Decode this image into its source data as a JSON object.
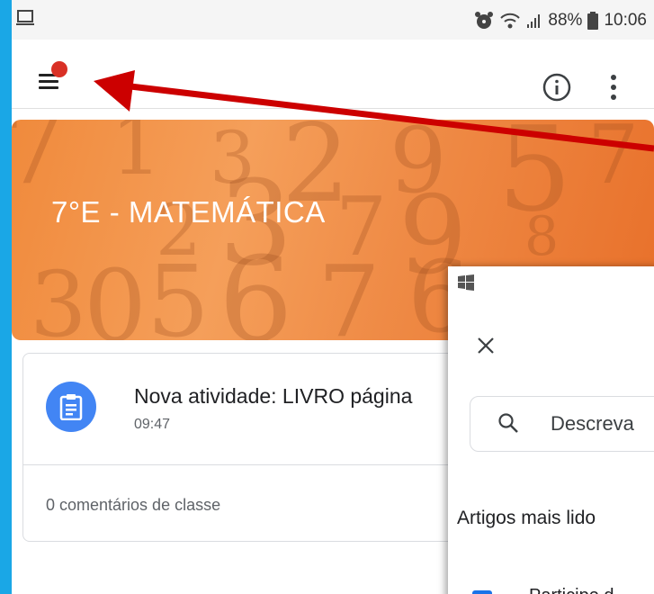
{
  "status_bar": {
    "icons": [
      "screen-icon",
      "alarm-icon",
      "wifi-icon",
      "signal-icon",
      "battery-icon"
    ],
    "battery_percent": "88%",
    "time": "10:06"
  },
  "app_bar": {
    "icons": [
      "menu-icon",
      "info-icon",
      "more-vert-icon"
    ],
    "notification_dot_color": "#d93025"
  },
  "banner": {
    "course_title": "7°E - MATEMÁTICA",
    "theme_color": "#f08a3c"
  },
  "post": {
    "icon": "assignment-icon",
    "title": "Nova atividade: LIVRO página",
    "time": "09:47",
    "comments": "0 comentários de classe"
  },
  "help_panel": {
    "close_icon": "close-icon",
    "search_placeholder": "Descreva",
    "section_heading": "Artigos mais lido",
    "article_text": "Participe d"
  },
  "annotation": {
    "arrow_color": "#cc0000"
  }
}
